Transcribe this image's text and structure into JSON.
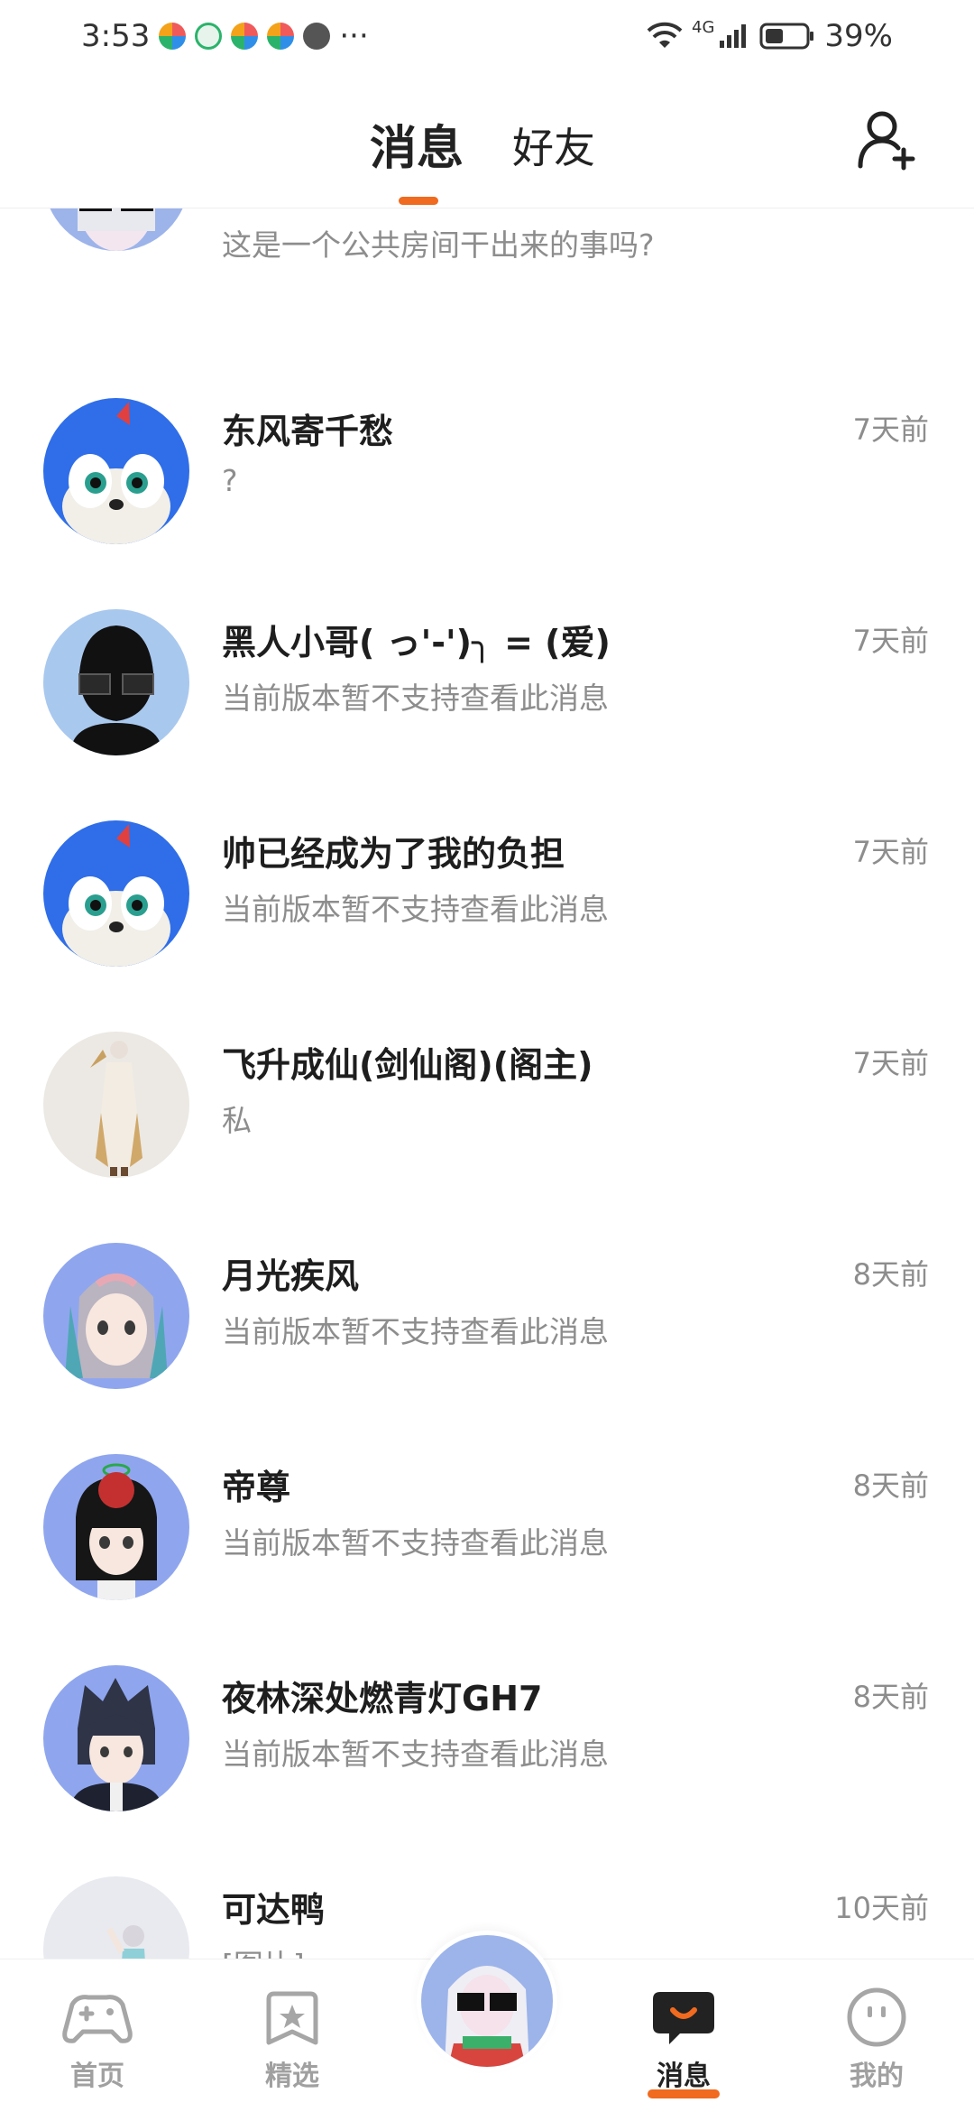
{
  "status_bar": {
    "time": "3:53",
    "more": "···",
    "network": "4G",
    "battery_percent": "39%",
    "colors": {
      "icon1": "#f05a5a",
      "icon2": "#2bb36b",
      "icon3": "#2f8fe8",
      "icon4": "#f3a21a",
      "icon5": "#555555"
    }
  },
  "header": {
    "tab_messages": "消息",
    "tab_friends": "好友",
    "active_tab": "消息",
    "accent": "#f06a1f"
  },
  "messages": [
    {
      "name": "",
      "preview": "这是一个公共房间干出来的事吗?",
      "time": "",
      "avatar": "glasses-white-hair"
    },
    {
      "name": "东风寄千愁",
      "preview": "?",
      "time": "7天前",
      "avatar": "blue-hedgehog"
    },
    {
      "name": "黑人小哥( っ'-')╮ = (爱)",
      "preview": "当前版本暂不支持查看此消息",
      "time": "7天前",
      "avatar": "black-silhouette"
    },
    {
      "name": "帅已经成为了我的负担",
      "preview": "当前版本暂不支持查看此消息",
      "time": "7天前",
      "avatar": "blue-hedgehog"
    },
    {
      "name": "飞升成仙(剑仙阁)(阁主)",
      "preview": "私",
      "time": "7天前",
      "avatar": "immortal-figure"
    },
    {
      "name": "月光疾风",
      "preview": "当前版本暂不支持查看此消息",
      "time": "8天前",
      "avatar": "pink-hair-girl"
    },
    {
      "name": "帝尊",
      "preview": "当前版本暂不支持查看此消息",
      "time": "8天前",
      "avatar": "black-hair-girl"
    },
    {
      "name": "夜林深处燃青灯GH7",
      "preview": "当前版本暂不支持查看此消息",
      "time": "8天前",
      "avatar": "dark-hair-boy"
    },
    {
      "name": "可达鸭",
      "preview": "[图片]",
      "time": "10天前",
      "avatar": "small-figure"
    }
  ],
  "bottom_nav": {
    "home": "首页",
    "featured": "精选",
    "messages": "消息",
    "mine": "我的",
    "active": "消息"
  }
}
